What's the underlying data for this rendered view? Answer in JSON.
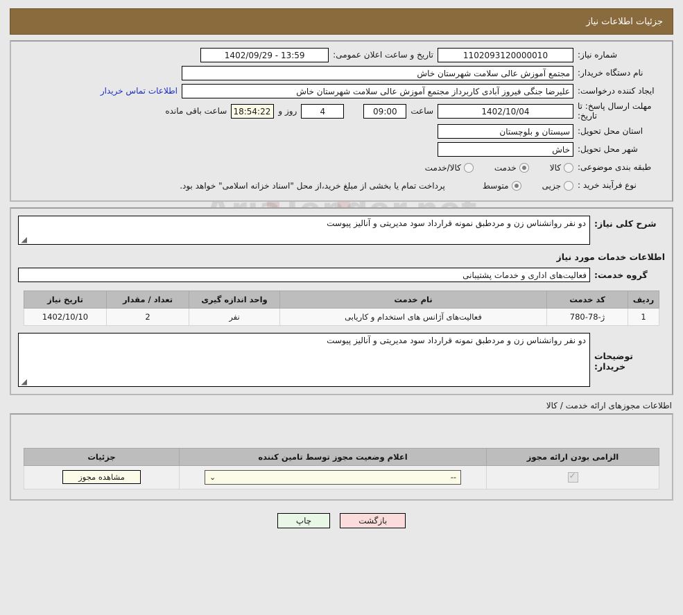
{
  "header": {
    "title": "جزئیات اطلاعات نیاز"
  },
  "form": {
    "need_number_label": "شماره نیاز:",
    "need_number_value": "1102093120000010",
    "announce_label": "تاریخ و ساعت اعلان عمومی:",
    "announce_value": "13:59 - 1402/09/29",
    "buyer_org_label": "نام دستگاه خریدار:",
    "buyer_org_value": "مجتمع آموزش عالی سلامت شهرستان خاش",
    "creator_label": "ایجاد کننده درخواست:",
    "creator_value": "علیرضا جنگی فیروز آبادی کاربرداز مجتمع آموزش عالی سلامت شهرستان خاش",
    "contact_link": "اطلاعات تماس خریدار",
    "deadline_label": "مهلت ارسال پاسخ: تا تاریخ:",
    "deadline_date": "1402/10/04",
    "hour_label": "ساعت",
    "deadline_time": "09:00",
    "days_value": "4",
    "days_label": "روز و",
    "countdown_value": "18:54:22",
    "countdown_label": "ساعت باقی مانده",
    "province_label": "استان محل تحویل:",
    "province_value": "سیستان و بلوچستان",
    "city_label": "شهر محل تحویل:",
    "city_value": "خاش",
    "category_label": "طبقه بندی موضوعی:",
    "category_options": [
      {
        "label": "کالا",
        "checked": false
      },
      {
        "label": "خدمت",
        "checked": true
      },
      {
        "label": "کالا/خدمت",
        "checked": false
      }
    ],
    "process_label": "نوع فرآیند خرید :",
    "process_options": [
      {
        "label": "جزیی",
        "checked": false
      },
      {
        "label": "متوسط",
        "checked": true
      }
    ],
    "process_note": "پرداخت تمام یا بخشی از مبلغ خرید،از محل \"اسناد خزانه اسلامی\" خواهد بود."
  },
  "description": {
    "need_desc_label": "شرح کلی نیاز:",
    "need_desc_value": "دو نفر روانشناس زن و مردطبق نمونه قرارداد سود مدیریتی و آنالیز پیوست",
    "services_section_title": "اطلاعات خدمات مورد نیاز",
    "service_group_label": "گروه خدمت:",
    "service_group_value": "فعالیت‌های اداری و خدمات پشتیبانی"
  },
  "services_table": {
    "columns": [
      "ردیف",
      "کد خدمت",
      "نام خدمت",
      "واحد اندازه گیری",
      "تعداد / مقدار",
      "تاریخ نیاز"
    ],
    "rows": [
      {
        "row": "1",
        "code": "ژ-78-780",
        "name": "فعالیت‌های آژانس های استخدام و کاریابی",
        "unit": "نفر",
        "quantity": "2",
        "need_date": "1402/10/10"
      }
    ]
  },
  "buyer_notes": {
    "label": "توضیحات خریدار:",
    "value": "دو نفر روانشناس زن و مردطبق نمونه قرارداد سود مدیریتی و آنالیز پیوست"
  },
  "permits": {
    "caption": "اطلاعات مجوزهای ارائه خدمت / کالا",
    "columns": [
      "الزامی بودن ارائه مجوز",
      "اعلام وضعیت مجوز توسط تامین کننده",
      "جزئیات"
    ],
    "rows": [
      {
        "required_checked": true,
        "status_value": "--",
        "details_button": "مشاهده مجوز"
      }
    ]
  },
  "footer": {
    "print_label": "چاپ",
    "back_label": "بازگشت"
  },
  "watermark": {
    "text": "AriaTender.net"
  },
  "colors": {
    "header_bg": "#8a6b3d",
    "link": "#1a2ec4",
    "print_btn": "#e9f7e6",
    "back_btn": "#fbdcdc",
    "table_header": "#bdbdbd",
    "yellow_field": "#fbfbe8"
  }
}
